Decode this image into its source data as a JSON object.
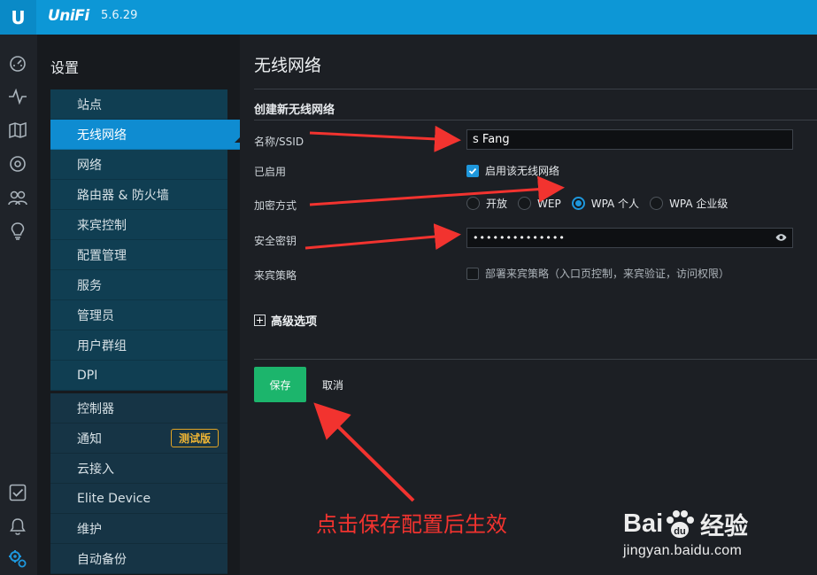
{
  "header": {
    "logo_letter": "U",
    "brand": "UniFi",
    "version": "5.6.29"
  },
  "rail": {
    "icons": [
      "dashboard-icon",
      "statistics-icon",
      "map-icon",
      "devices-icon",
      "clients-icon",
      "insights-icon",
      "events-icon",
      "alerts-icon",
      "settings-icon"
    ]
  },
  "sidebar": {
    "title": "设置",
    "group1": [
      "站点",
      "无线网络",
      "网络",
      "路由器 & 防火墙",
      "来宾控制",
      "配置管理",
      "服务",
      "管理员",
      "用户群组",
      "DPI"
    ],
    "active_index": 1,
    "group2": [
      "控制器",
      "通知",
      "云接入",
      "Elite Device",
      "维护",
      "自动备份"
    ],
    "notify_badge": "测试版"
  },
  "main": {
    "title": "无线网络",
    "section_title": "创建新无线网络",
    "labels": {
      "ssid": "名称/SSID",
      "enabled": "已启用",
      "security": "加密方式",
      "key": "安全密钥",
      "guest": "来宾策略"
    },
    "ssid_value": "s Fang",
    "enable_label": "启用该无线网络",
    "security_options": [
      "开放",
      "WEP",
      "WPA 个人",
      "WPA 企业级"
    ],
    "security_selected": 2,
    "key_value": "••••••••••••••",
    "guest_label": "部署来宾策略（入口页控制，来宾验证，访问权限）",
    "advanced_label": "高级选项",
    "save_label": "保存",
    "cancel_label": "取消"
  },
  "annotation": {
    "note": "点击保存配置后生效",
    "color": "#f2332f"
  },
  "watermark": {
    "logo": "Bai",
    "logo_cn": "经验",
    "url": "jingyan.baidu.com"
  },
  "colors": {
    "topbar": "#0d97d6",
    "active": "#0f8cd1",
    "save": "#1cb56c",
    "badge": "#e0a324"
  }
}
